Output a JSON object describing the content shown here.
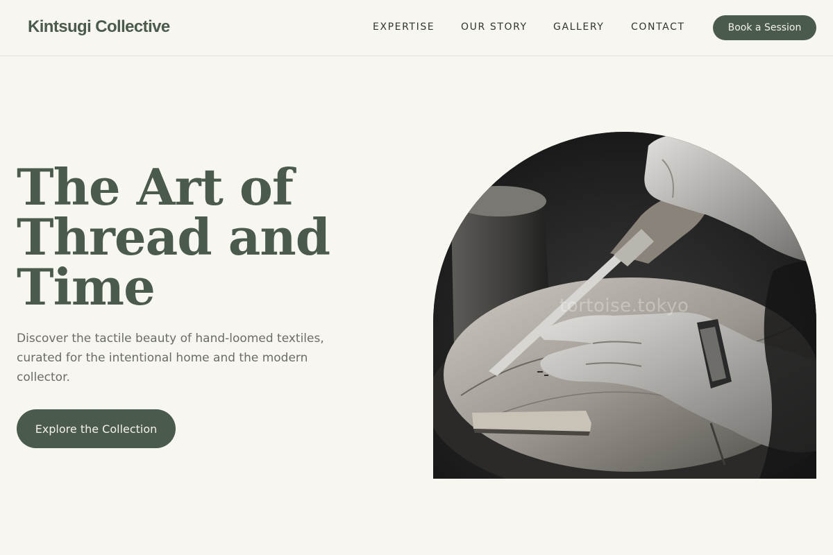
{
  "header": {
    "brand": "Kintsugi Collective",
    "nav": [
      {
        "label": "EXPERTISE"
      },
      {
        "label": "OUR STORY"
      },
      {
        "label": "GALLERY"
      },
      {
        "label": "CONTACT"
      }
    ],
    "cta_label": "Book a Session"
  },
  "hero": {
    "title_lines": [
      "The Art of",
      "Thread and",
      "Time"
    ],
    "subtitle": "Discover the tactile beauty of hand-loomed textiles, curated for the intentional home and the modern collector.",
    "button_label": "Explore the Collection",
    "image": {
      "description_icon": "craftsman-carving-photo",
      "watermark": "tortoise.tokyo"
    }
  },
  "colors": {
    "background": "#f8f6f1",
    "accent": "#4a5a4c",
    "text_dark": "#2f3530",
    "text_muted": "#6b6c67"
  }
}
